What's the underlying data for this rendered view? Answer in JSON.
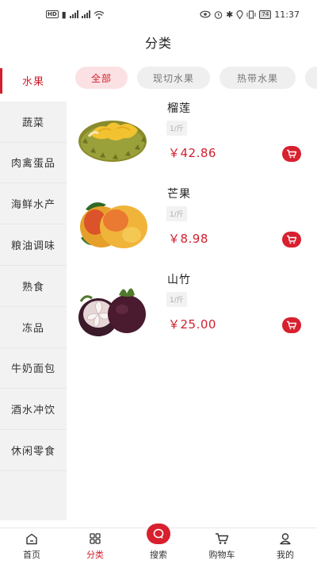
{
  "status_bar": {
    "time": "11:37",
    "battery": "74",
    "network_1": "3G",
    "network_2": "4G"
  },
  "header": {
    "title": "分类"
  },
  "sidebar": {
    "items": [
      {
        "label": "水果"
      },
      {
        "label": "蔬菜"
      },
      {
        "label": "肉禽蛋品"
      },
      {
        "label": "海鲜水产"
      },
      {
        "label": "粮油调味"
      },
      {
        "label": "熟食"
      },
      {
        "label": "冻品"
      },
      {
        "label": "牛奶面包"
      },
      {
        "label": "酒水冲饮"
      },
      {
        "label": "休闲零食"
      }
    ],
    "active_index": 0
  },
  "tabs": {
    "items": [
      {
        "label": "全部"
      },
      {
        "label": "现切水果"
      },
      {
        "label": "热带水果"
      },
      {
        "label": ""
      }
    ]
  },
  "products": [
    {
      "name": "榴莲",
      "unit": "1/斤",
      "price": "￥42.86",
      "image_icon": "durian-image"
    },
    {
      "name": "芒果",
      "unit": "1/斤",
      "price": "￥8.98",
      "image_icon": "mango-image"
    },
    {
      "name": "山竹",
      "unit": "1/斤",
      "price": "￥25.00",
      "image_icon": "mangosteen-image"
    }
  ],
  "tabbar": {
    "items": [
      {
        "label": "首页",
        "icon": "home-icon"
      },
      {
        "label": "分类",
        "icon": "category-icon"
      },
      {
        "label": "搜索",
        "icon": "search-icon"
      },
      {
        "label": "购物车",
        "icon": "cart-icon"
      },
      {
        "label": "我的",
        "icon": "user-icon"
      }
    ],
    "active_index": 1
  },
  "colors": {
    "accent": "#d21f2e",
    "sidebar_bg": "#f2f2f2",
    "tab_active_bg": "#fbe1e3"
  }
}
